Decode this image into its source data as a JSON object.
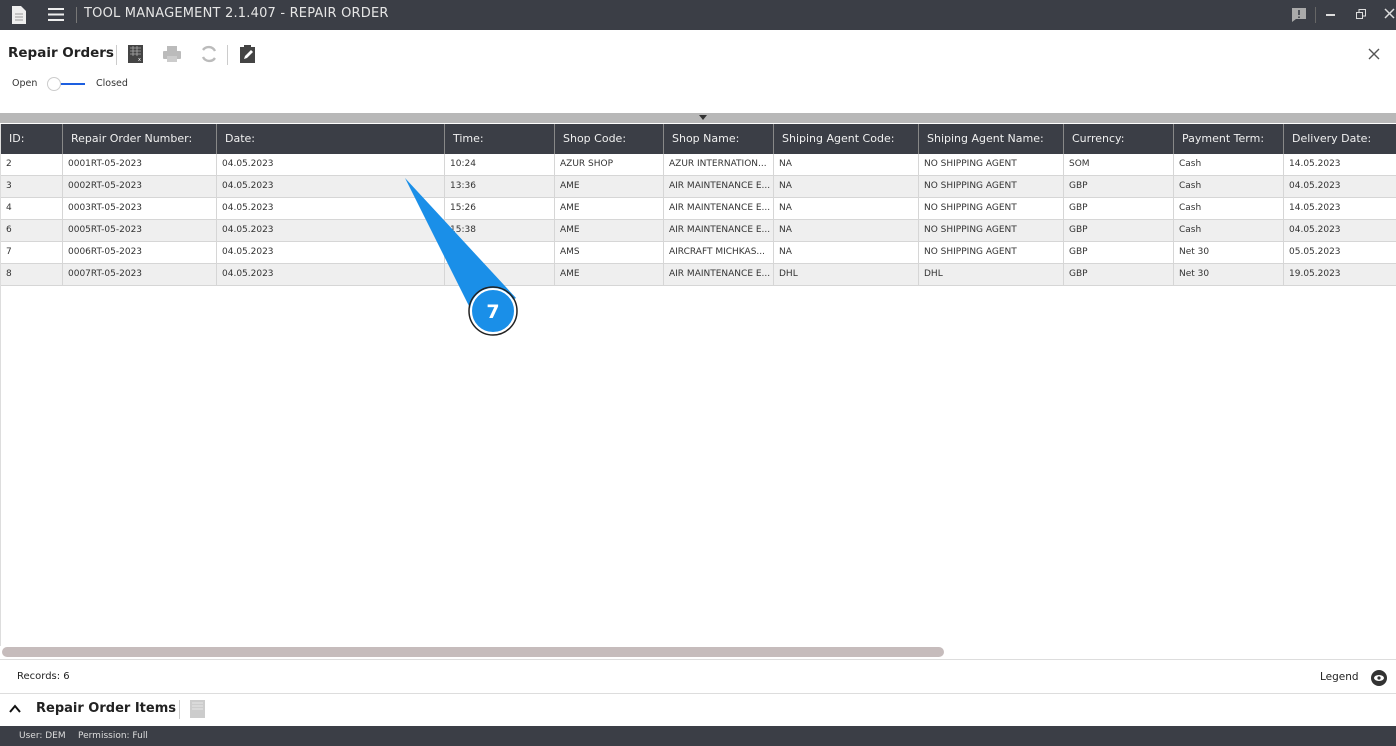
{
  "window": {
    "title": "TOOL MANAGEMENT 2.1.407 - REPAIR ORDER"
  },
  "toolbar": {
    "title": "Repair Orders",
    "toggle_left": "Open",
    "toggle_right": "Closed",
    "toggle_state": "Open"
  },
  "table": {
    "columns": [
      "ID:",
      "Repair Order Number:",
      "Date:",
      "Time:",
      "Shop Code:",
      "Shop Name:",
      "Shiping Agent Code:",
      "Shiping Agent Name:",
      "Currency:",
      "Payment Term:",
      "Delivery Date:"
    ],
    "rows": [
      [
        "2",
        "0001RT-05-2023",
        "04.05.2023",
        "10:24",
        "AZUR SHOP",
        "AZUR INTERNATION...",
        "NA",
        "NO SHIPPING AGENT",
        "SOM",
        "Cash",
        "14.05.2023"
      ],
      [
        "3",
        "0002RT-05-2023",
        "04.05.2023",
        "13:36",
        "AME",
        "AIR MAINTENANCE E...",
        "NA",
        "NO SHIPPING AGENT",
        "GBP",
        "Cash",
        "04.05.2023"
      ],
      [
        "4",
        "0003RT-05-2023",
        "04.05.2023",
        "15:26",
        "AME",
        "AIR MAINTENANCE E...",
        "NA",
        "NO SHIPPING AGENT",
        "GBP",
        "Cash",
        "14.05.2023"
      ],
      [
        "6",
        "0005RT-05-2023",
        "04.05.2023",
        "15:38",
        "AME",
        "AIR MAINTENANCE E...",
        "NA",
        "NO SHIPPING AGENT",
        "GBP",
        "Cash",
        "04.05.2023"
      ],
      [
        "7",
        "0006RT-05-2023",
        "04.05.2023",
        "",
        "AMS",
        "AIRCRAFT MICHKAS...",
        "NA",
        "NO SHIPPING AGENT",
        "GBP",
        "Net 30",
        "05.05.2023"
      ],
      [
        "8",
        "0007RT-05-2023",
        "04.05.2023",
        "",
        "AME",
        "AIR MAINTENANCE E...",
        "DHL",
        "DHL",
        "GBP",
        "Net 30",
        "19.05.2023"
      ]
    ]
  },
  "footer": {
    "records": "Records: 6",
    "legend": "Legend"
  },
  "items_panel": {
    "title": "Repair Order Items"
  },
  "status": {
    "user": "User: DEM",
    "permission": "Permission: Full"
  },
  "callout": {
    "number": "7",
    "color": "#1a8fe8"
  }
}
